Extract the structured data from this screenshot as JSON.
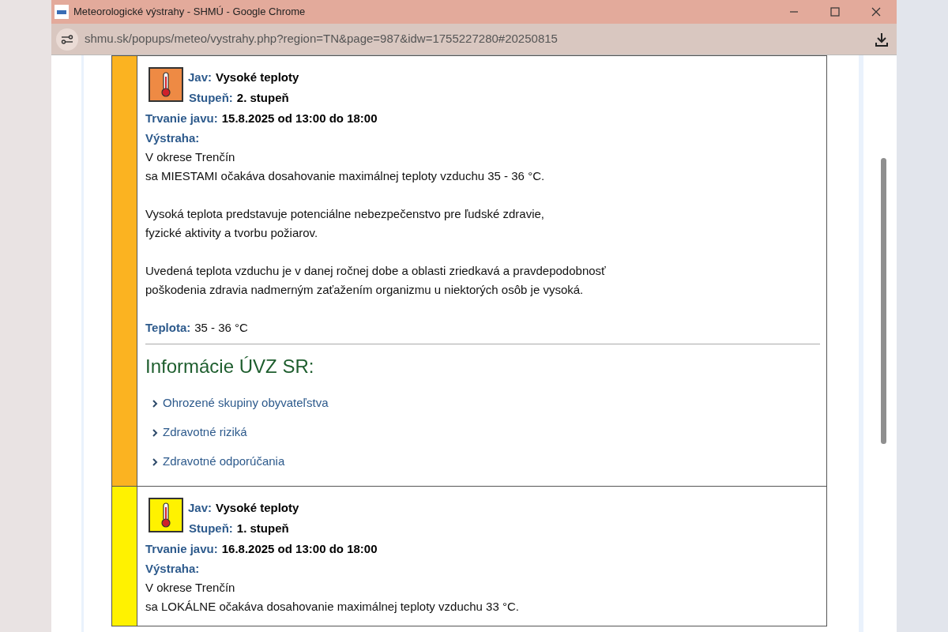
{
  "window": {
    "title": "Meteorologické výstrahy - SHMÚ - Google Chrome",
    "url": "shmu.sk/popups/meteo/vystrahy.php?region=TN&page=987&idw=1755227280#20250815"
  },
  "warnings": [
    {
      "color": "#fbb321",
      "kind": "moderate",
      "phenomenon_label": "Jav:",
      "phenomenon": "Vysoké teploty",
      "degree_label": "Stupeň:",
      "degree": "2. stupeň",
      "duration_label": "Trvanie javu:",
      "duration": "15.8.2025 od 13:00 do 18:00",
      "warning_label": "Výstraha:",
      "paragraphs": [
        [
          "V okrese Trenčín",
          "sa MIESTAMI očakáva dosahovanie maximálnej teploty vzduchu 35 - 36 °C."
        ],
        [
          "Vysoká teplota predstavuje potenciálne nebezpečenstvo pre ľudské zdravie,",
          "fyzické aktivity a tvorbu požiarov."
        ],
        [
          "Uvedená teplota vzduchu je v danej ročnej dobe a oblasti zriedkavá a pravdepodobnosť",
          "poškodenia zdravia nadmerným zaťažením organizmu u niektorých osôb je vysoká."
        ]
      ],
      "temperature_label": "Teplota:",
      "temperature": "35 - 36 °C",
      "info_heading": "Informácie ÚVZ SR:",
      "info_links": [
        "Ohrozené skupiny obyvateľstva",
        "Zdravotné riziká",
        "Zdravotné odporúčania"
      ]
    },
    {
      "color": "#fff200",
      "kind": "low",
      "phenomenon_label": "Jav:",
      "phenomenon": "Vysoké teploty",
      "degree_label": "Stupeň:",
      "degree": "1. stupeň",
      "duration_label": "Trvanie javu:",
      "duration": "16.8.2025 od 13:00 do 18:00",
      "warning_label": "Výstraha:",
      "paragraphs": [
        [
          "V okrese Trenčín",
          "sa LOKÁLNE očakáva dosahovanie maximálnej teploty vzduchu 33 °C."
        ]
      ]
    }
  ]
}
